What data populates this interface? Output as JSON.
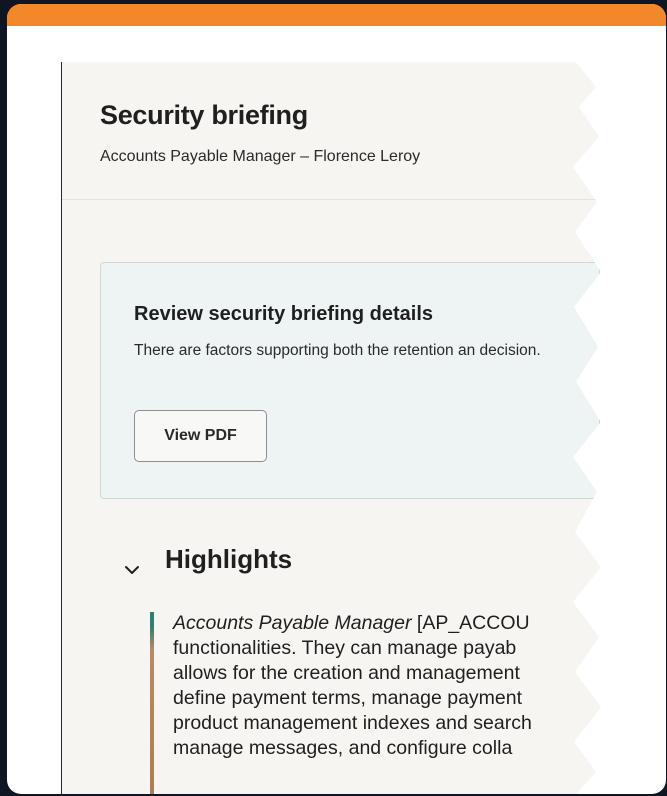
{
  "briefing": {
    "title": "Security briefing",
    "subtitle": "Accounts Payable Manager – Florence Leroy"
  },
  "review_card": {
    "title": "Review security briefing details",
    "text": "There are factors supporting both the retention an decision.",
    "button_label": "View PDF"
  },
  "highlights": {
    "heading": "Highlights",
    "quote_lines": [
      {
        "italic": "Accounts Payable Manager",
        "rest": " [AP_ACCOU"
      },
      "functionalities. They can manage payab",
      "allows for the creation and management",
      "define payment terms, manage payment",
      "product management indexes and search",
      "manage messages, and configure colla"
    ]
  },
  "colors": {
    "accent_bar": "#f2882a",
    "background": "#0e1623",
    "card_background": "#eef3f3",
    "quote_bar_top": "#2f7f73",
    "quote_bar_bottom": "#b07a52"
  },
  "icons": {
    "collapse": "chevron-down-icon"
  }
}
